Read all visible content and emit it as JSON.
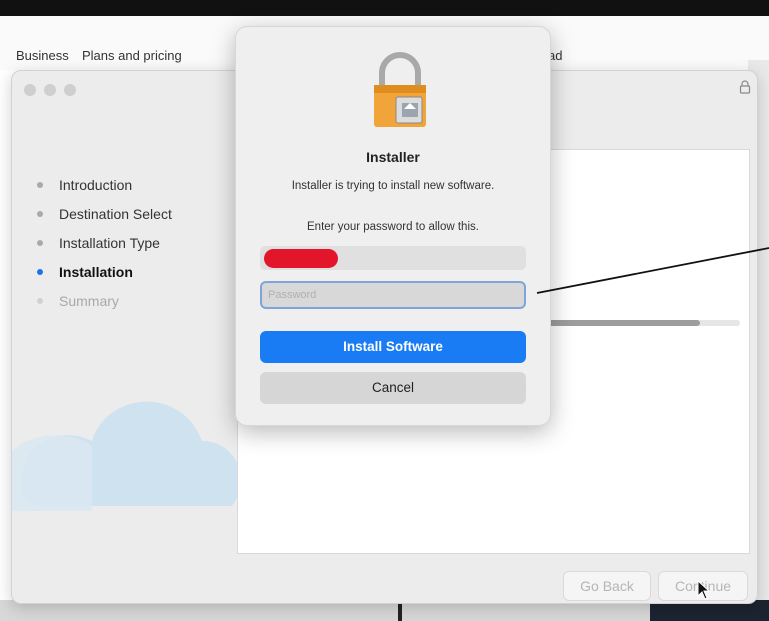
{
  "website_nav": {
    "items": [
      "Business",
      "Plans and pricing",
      "ad"
    ]
  },
  "installer": {
    "steps": [
      {
        "label": "Introduction",
        "state": "done"
      },
      {
        "label": "Destination Select",
        "state": "done"
      },
      {
        "label": "Installation Type",
        "state": "done"
      },
      {
        "label": "Installation",
        "state": "active"
      },
      {
        "label": "Summary",
        "state": "future"
      }
    ],
    "progress": 0.8,
    "go_back_label": "Go Back",
    "continue_label": "Continue"
  },
  "auth_dialog": {
    "title": "Installer",
    "message": "Installer is trying to install new software.",
    "prompt": "Enter your password to allow this.",
    "password_placeholder": "Password",
    "install_label": "Install Software",
    "cancel_label": "Cancel"
  },
  "colors": {
    "accent": "#1a7cf5",
    "redaction": "#e3152b",
    "active_step_dot": "#1a73e8"
  },
  "icons": [
    "lock-icon",
    "installer-lock-icon",
    "cloud-graphic",
    "cursor-icon"
  ]
}
